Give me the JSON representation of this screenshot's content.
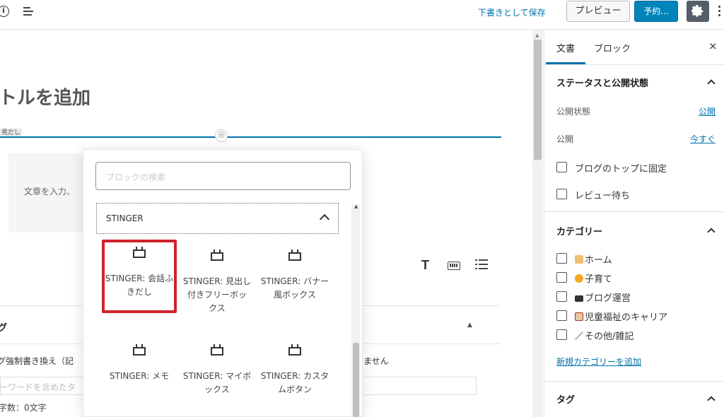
{
  "toolbar": {
    "info_icon": "info-icon",
    "outline_icon": "list-view-icon",
    "save_draft": "下書きとして保存",
    "preview": "プレビュー",
    "publish": "予約...",
    "settings_icon": "gear-icon",
    "more_icon": "more-vertical-icon"
  },
  "editor": {
    "title": "トルを追加",
    "heading_tag": "見だし",
    "paragraph_placeholder": "文章を入力、",
    "meta_box": {
      "title": "グ",
      "text": "グ強制書き換え（記",
      "text_right": "ません",
      "input_placeholder": "ーワードを含めたタ",
      "char_count": "字数：0文字"
    }
  },
  "inserter": {
    "search_placeholder": "ブロックの検索",
    "panel_title": "STINGER",
    "blocks": [
      {
        "label": "STINGER: 会話ふきだし",
        "line1": "STINGER: 会話ふ",
        "line2": "きだし",
        "line3": "",
        "selected": true
      },
      {
        "label": "STINGER: 見出し付きフリーボックス",
        "line1": "STINGER: 見出し",
        "line2": "付きフリーボッ",
        "line3": "クス",
        "selected": false
      },
      {
        "label": "STINGER: バナー風ボックス",
        "line1": "STINGER: バナー",
        "line2": "風ボックス",
        "line3": "",
        "selected": false
      },
      {
        "label": "STINGER: メモ",
        "line1": "STINGER: メモ",
        "line2": "",
        "line3": "",
        "selected": false
      },
      {
        "label": "STINGER: マイボックス",
        "line1": "STINGER: マイボ",
        "line2": "ックス",
        "line3": "",
        "selected": false
      },
      {
        "label": "STINGER: カスタムボタン",
        "line1": "STINGER: カスタ",
        "line2": "ムボタン",
        "line3": "",
        "selected": false
      }
    ]
  },
  "sidebar": {
    "tabs": [
      "文書",
      "ブロック"
    ],
    "close": "×",
    "status_section": {
      "title": "ステータスと公開状態",
      "visibility_label": "公開状態",
      "visibility_value": "公開",
      "publish_label": "公開",
      "publish_value": "今すぐ",
      "sticky": "ブログのトップに固定",
      "pending": "レビュー待ち"
    },
    "categories_section": {
      "title": "カテゴリー",
      "items": [
        "ホーム",
        "子育て",
        "ブログ運営",
        "児童福祉のキャリア",
        "その他/雑記"
      ],
      "add_new": "新規カテゴリーを追加"
    },
    "tags_section": {
      "title": "タグ"
    }
  },
  "colors": {
    "accent": "#0073aa",
    "publish_button": "#0085ba",
    "selected_outline": "#d0222b"
  }
}
